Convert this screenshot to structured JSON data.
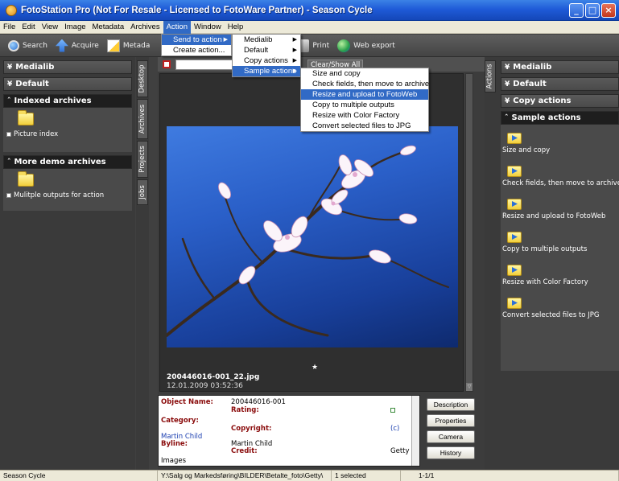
{
  "window": {
    "title": "FotoStation Pro (Not For Resale - Licensed to FotoWare Partner) - Season Cycle",
    "controls": [
      "_",
      "□",
      "×"
    ]
  },
  "menubar": [
    "File",
    "Edit",
    "View",
    "Image",
    "Metadata",
    "Archives",
    "Action",
    "Window",
    "Help"
  ],
  "toolbar": {
    "search": "Search",
    "acquire": "Acquire",
    "metadata": "Metada",
    "print": "Print",
    "web_export": "Web export"
  },
  "left_panel": {
    "medialib": "Medialib",
    "default": "Default",
    "indexed_archives": "Indexed archives",
    "picture_index": "Picture index",
    "more_demo": "More demo archives",
    "multiple_outputs": "Mulitple outputs for action"
  },
  "left_tabs": [
    "Desktop",
    "Archives",
    "Projects",
    "Jobs"
  ],
  "right_tabs": [
    "Actions"
  ],
  "main": {
    "clear_show_all": "Clear/Show All",
    "filename": "200446016-001_22.jpg",
    "date": "12.01.2009 03:52:36"
  },
  "metadata": {
    "object_name_label": "Object Name:",
    "object_name_value": "200446016-001",
    "rating_label": "Rating:",
    "category_label": "Category:",
    "copyright_label": "Copyright:",
    "copyright_value": "(c)",
    "author": "Martin Child",
    "byline_label": "Byline:",
    "byline_value": "Martin Child",
    "credit_label": "Credit:",
    "credit_value": "Getty",
    "images": "Images"
  },
  "meta_buttons": [
    "Description",
    "Properties",
    "Camera",
    "History"
  ],
  "right_panel": {
    "medialib": "Medialib",
    "default": "Default",
    "copy_actions": "Copy actions",
    "sample_actions": "Sample actions",
    "actions": [
      "Size and copy",
      "Check fields, then move to archive",
      "Resize and upload to FotoWeb",
      "Copy to multiple outputs",
      "Resize with Color Factory",
      "Convert selected files to JPG"
    ]
  },
  "menu_action": [
    "Send to action",
    "Create action..."
  ],
  "menu_sendto": [
    "Medialib",
    "Default",
    "Copy actions",
    "Sample actions"
  ],
  "menu_sample": [
    "Size and copy",
    "Check fields, then move to archive",
    "Resize and upload to FotoWeb",
    "Copy to multiple outputs",
    "Resize with Color Factory",
    "Convert selected files to JPG"
  ],
  "statusbar": {
    "name": "Season Cycle",
    "path": "Y:\\Salg og Markedsføring\\BILDER\\Betalte_foto\\Getty\\",
    "selected": "1 selected",
    "count": "1-1/1"
  }
}
